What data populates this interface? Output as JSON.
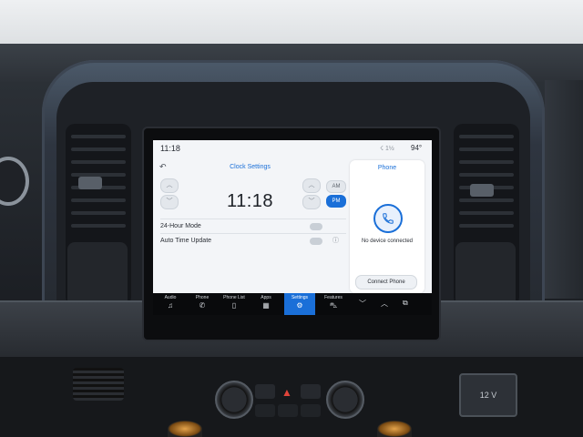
{
  "status": {
    "time": "11:18",
    "icons": "☇ 1½",
    "temperature": "94°"
  },
  "clock": {
    "title": "Clock Settings",
    "time": "11:18",
    "am_label": "AM",
    "pm_label": "PM",
    "selected_period": "PM",
    "rows": [
      {
        "label": "24-Hour Mode",
        "enabled": false
      },
      {
        "label": "Auto Time Update",
        "enabled": false
      }
    ]
  },
  "phone": {
    "title": "Phone",
    "status": "No device connected",
    "connect_label": "Connect Phone"
  },
  "taskbar": {
    "items": [
      {
        "label": "Audio",
        "icon": "♫"
      },
      {
        "label": "Phone",
        "icon": "✆"
      },
      {
        "label": "Phone List",
        "icon": "▯"
      },
      {
        "label": "Apps",
        "icon": "▦"
      },
      {
        "label": "Settings",
        "icon": "⚙",
        "active": true
      },
      {
        "label": "Features",
        "icon": "⛍"
      }
    ]
  },
  "console": {
    "usb_label": "12 V"
  },
  "colors": {
    "accent": "#1a6fd8",
    "screen_bg": "#f3f5f8"
  }
}
